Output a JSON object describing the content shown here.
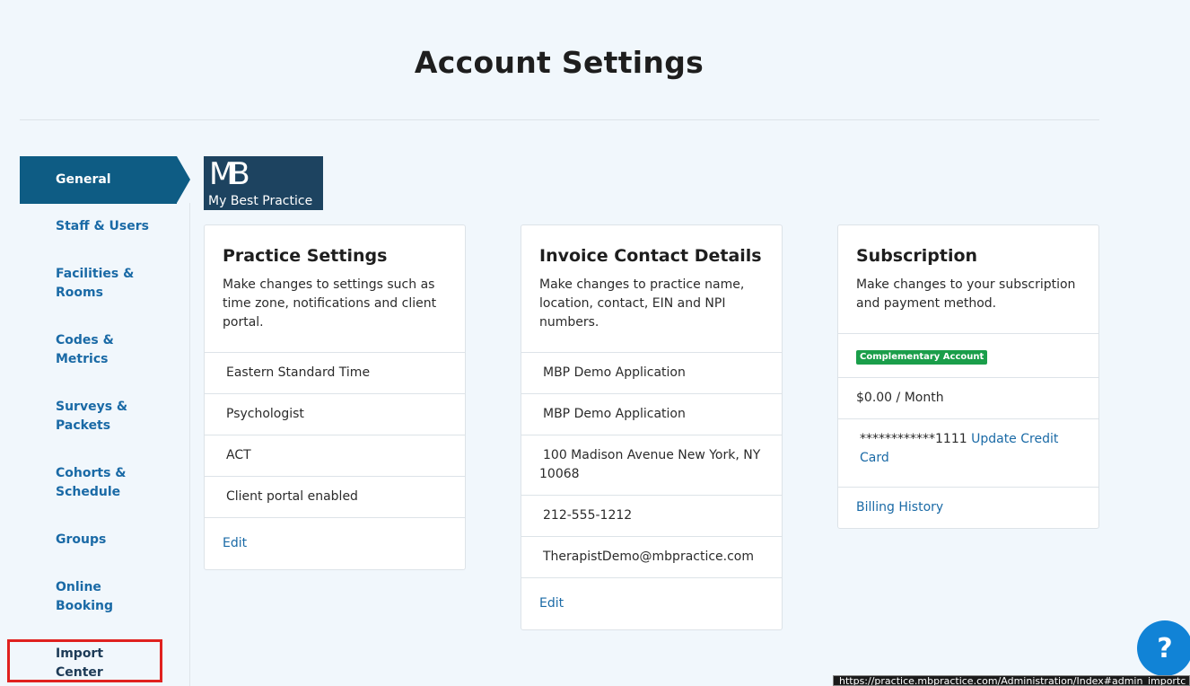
{
  "page": {
    "title": "Account Settings"
  },
  "sidebar": {
    "items": [
      {
        "label": "General"
      },
      {
        "label": "Staff & Users"
      },
      {
        "label": "Facilities &\nRooms"
      },
      {
        "label": "Codes &\nMetrics"
      },
      {
        "label": "Surveys &\nPackets"
      },
      {
        "label": "Cohorts &\nSchedule"
      },
      {
        "label": "Groups"
      },
      {
        "label": "Online\nBooking"
      },
      {
        "label": "Import\nCenter"
      }
    ]
  },
  "logo": {
    "mark": "MB",
    "tagline": "My Best Practice"
  },
  "practice_settings": {
    "title": "Practice Settings",
    "description": "Make changes to settings such as time zone, notifications and client portal.",
    "rows": [
      "Eastern Standard Time",
      "Psychologist",
      "ACT",
      "Client portal enabled"
    ],
    "edit_label": "Edit"
  },
  "invoice_contact": {
    "title": "Invoice Contact Details",
    "description": "Make changes to practice name, location, contact, EIN and NPI numbers.",
    "rows": [
      "MBP Demo Application",
      "MBP Demo Application",
      "100 Madison Avenue New York, NY 10068",
      "212-555-1212",
      "TherapistDemo@mbpractice.com"
    ],
    "edit_label": "Edit"
  },
  "subscription": {
    "title": "Subscription",
    "description": "Make changes to your subscription and payment method.",
    "badge": "Complementary Account",
    "price": "$0.00 / Month",
    "card_masked": "************1111",
    "update_card_label": "Update Credit Card",
    "billing_history_label": "Billing History"
  },
  "help": {
    "icon": "question-icon",
    "glyph": "?"
  },
  "status_bar": {
    "url": "https://practice.mbpractice.com/Administration/Index#admin_importc"
  },
  "colors": {
    "accent": "#0e5c84",
    "link": "#1a6aa6",
    "badge": "#1a9e4a",
    "help": "#1183d6",
    "highlight": "#e0211f"
  }
}
